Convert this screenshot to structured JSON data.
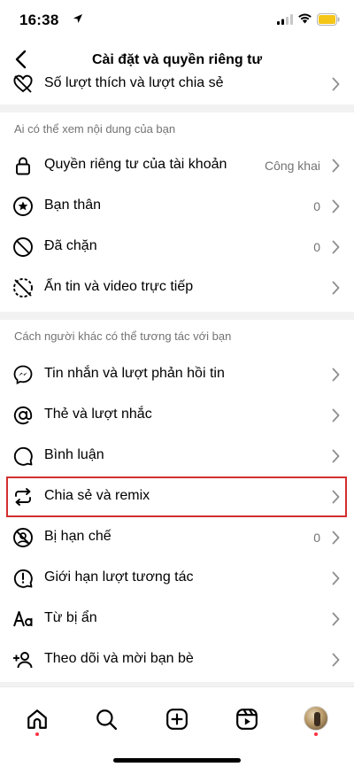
{
  "status_bar": {
    "time": "16:38"
  },
  "header": {
    "title": "Cài đặt và quyền riêng tư"
  },
  "top_partial_item": {
    "label": "Số lượt thích và lượt chia sẻ",
    "icon": "heart-off-icon"
  },
  "section_visibility": {
    "header": "Ai có thể xem nội dung của bạn",
    "items": [
      {
        "label": "Quyền riêng tư của tài khoản",
        "value": "Công khai",
        "icon": "lock-icon"
      },
      {
        "label": "Bạn thân",
        "value": "0",
        "icon": "star-circle-icon"
      },
      {
        "label": "Đã chặn",
        "value": "0",
        "icon": "block-icon"
      },
      {
        "label": "Ẩn tin và video trực tiếp",
        "value": "",
        "icon": "hide-story-icon"
      }
    ]
  },
  "section_interactions": {
    "header": "Cách người khác có thể tương tác với bạn",
    "items": [
      {
        "label": "Tin nhắn và lượt phản hồi tin",
        "value": "",
        "icon": "messenger-icon"
      },
      {
        "label": "Thẻ và lượt nhắc",
        "value": "",
        "icon": "at-sign-icon"
      },
      {
        "label": "Bình luận",
        "value": "",
        "icon": "comment-icon"
      },
      {
        "label": "Chia sẻ và remix",
        "value": "",
        "icon": "share-remix-icon",
        "highlighted": true
      },
      {
        "label": "Bị hạn chế",
        "value": "0",
        "icon": "restricted-icon"
      },
      {
        "label": "Giới hạn lượt tương tác",
        "value": "",
        "icon": "alert-circle-icon"
      },
      {
        "label": "Từ bị ẩn",
        "value": "",
        "icon": "text-aa-icon"
      },
      {
        "label": "Theo dõi và mời bạn bè",
        "value": "",
        "icon": "add-person-icon"
      }
    ]
  },
  "highlight_color": "#d32f2f",
  "bottom_nav": {
    "tabs": [
      "home-icon",
      "search-icon",
      "create-icon",
      "reels-icon",
      "profile-avatar"
    ],
    "notification_dot_color": "#ff3040"
  }
}
